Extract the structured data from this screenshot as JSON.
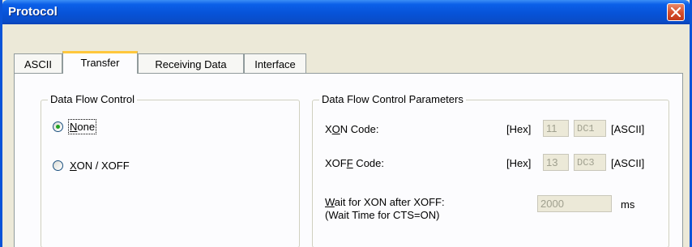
{
  "window": {
    "title": "Protocol"
  },
  "tabs": [
    {
      "label": "ASCII"
    },
    {
      "label": "Transfer"
    },
    {
      "label": "Receiving Data"
    },
    {
      "label": "Interface"
    }
  ],
  "flow_control": {
    "title": "Data Flow Control",
    "options": [
      {
        "label_pre": "",
        "label_u": "N",
        "label_post": "one",
        "selected": true
      },
      {
        "label_pre": "",
        "label_u": "X",
        "label_post": "ON / XOFF",
        "selected": false
      }
    ]
  },
  "params": {
    "title": "Data Flow Control Parameters",
    "xon": {
      "label_pre": "X",
      "label_u": "O",
      "label_post": "N Code:",
      "hex_tag": "[Hex]",
      "hex_value": "11",
      "ascii_value": "DC1",
      "ascii_tag": "[ASCII]"
    },
    "xoff": {
      "label_pre": "XOF",
      "label_u": "F",
      "label_post": " Code:",
      "hex_tag": "[Hex]",
      "hex_value": "13",
      "ascii_value": "DC3",
      "ascii_tag": "[ASCII]"
    },
    "wait": {
      "line1_u": "W",
      "line1_post": "ait for XON after XOFF:",
      "line2": "(Wait Time for CTS=ON)",
      "value": "2000",
      "unit": "ms"
    }
  },
  "colors": {
    "title_bar": "#0753d8",
    "active_tab_accent": "#ffc73c",
    "dialog_bg": "#ece9d8",
    "close_button": "#d6502e"
  }
}
